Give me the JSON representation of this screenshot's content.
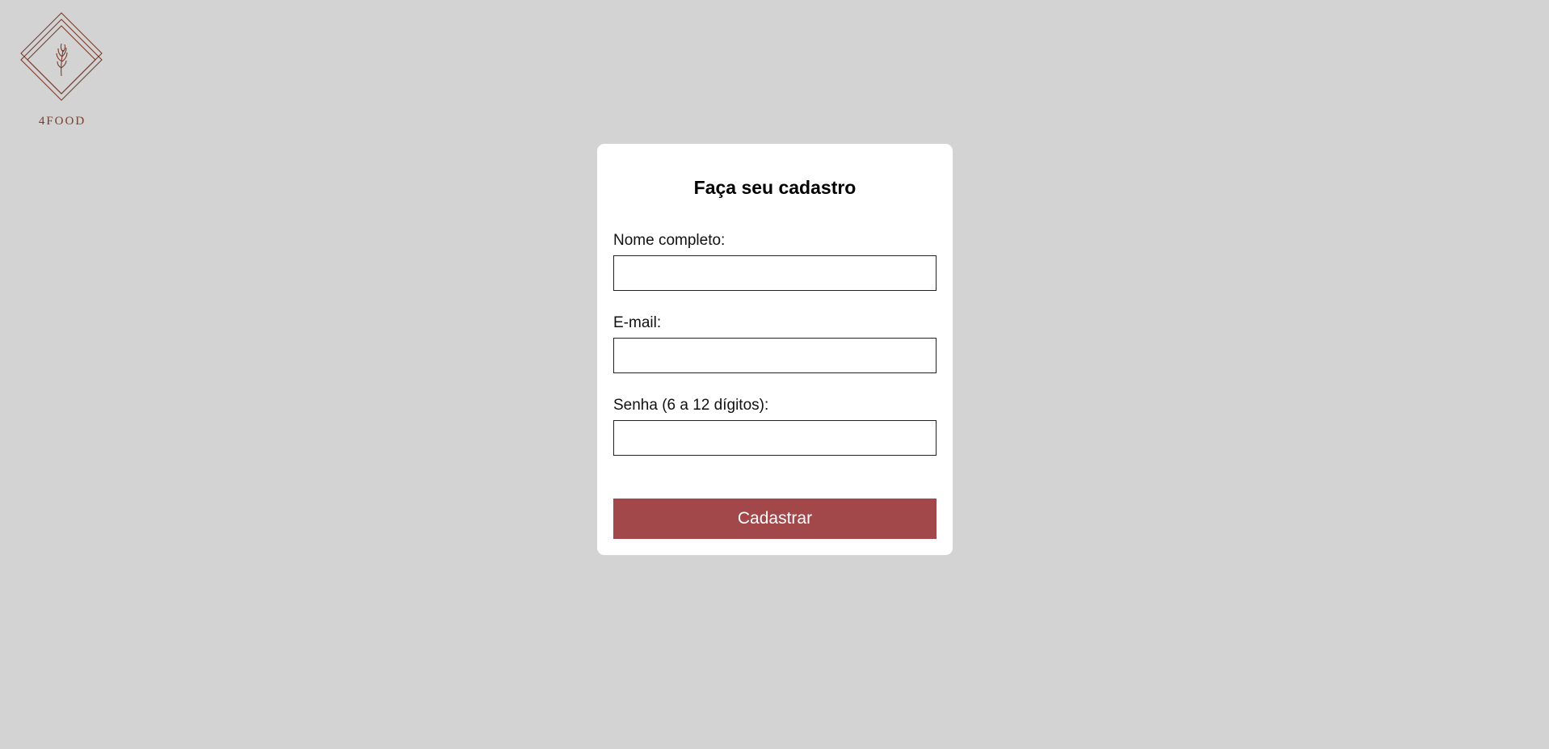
{
  "brand": {
    "name": "4FOOD",
    "logo_icon": "wheat-diamond-logo",
    "color": "#7a3b2a"
  },
  "form": {
    "title": "Faça seu cadastro",
    "fields": [
      {
        "label": "Nome completo:",
        "value": "",
        "placeholder": ""
      },
      {
        "label": "E-mail:",
        "value": "",
        "placeholder": ""
      },
      {
        "label": "Senha (6 a 12 dígitos):",
        "value": "",
        "placeholder": ""
      }
    ],
    "submit_label": "Cadastrar"
  },
  "colors": {
    "page_background": "#d3d3d3",
    "card_background": "#ffffff",
    "button_background": "#a2474a",
    "button_text": "#ffffff"
  }
}
